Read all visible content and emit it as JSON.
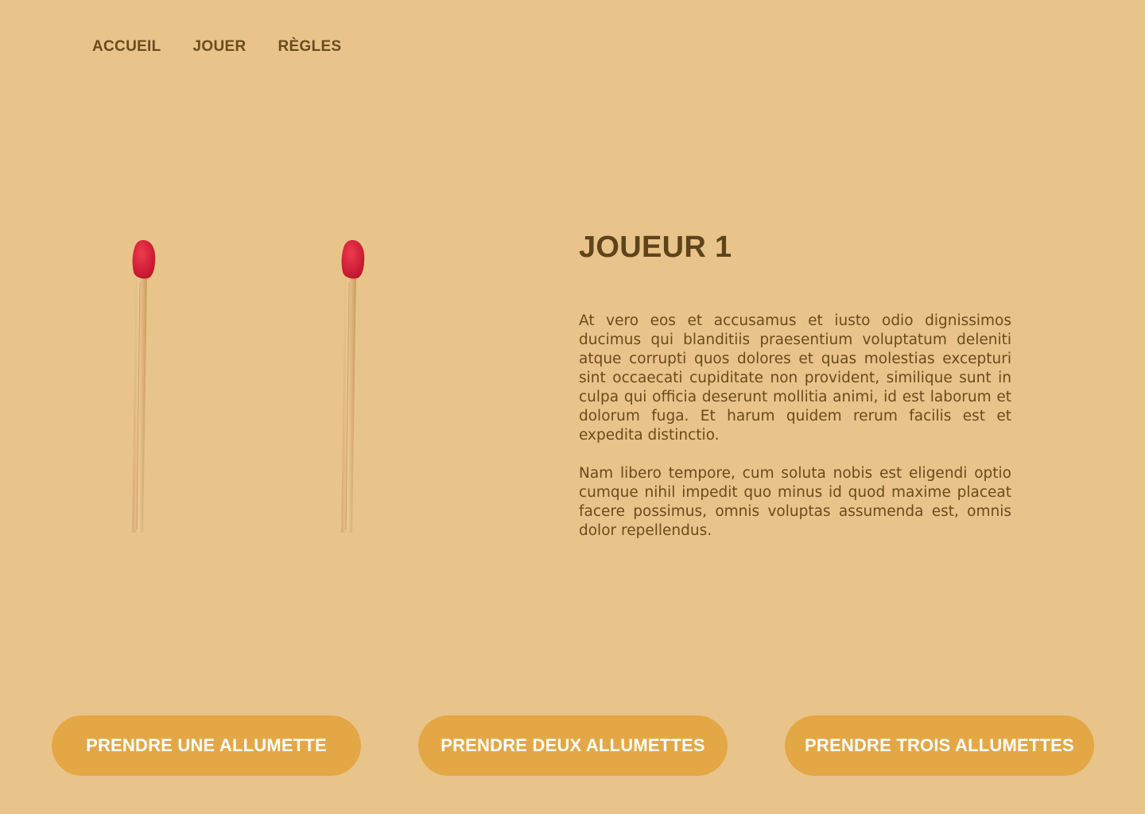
{
  "nav": {
    "items": [
      {
        "label": "ACCUEIL"
      },
      {
        "label": "JOUER"
      },
      {
        "label": "RÈGLES"
      }
    ]
  },
  "game": {
    "matches_remaining": 2
  },
  "player": {
    "title": "JOUEUR 1"
  },
  "content": {
    "paragraphs": [
      "At vero eos et accusamus et iusto odio dignissimos ducimus qui blanditiis praesentium voluptatum deleniti atque corrupti quos dolores et quas molestias excepturi sint occaecati cupiditate non provident, similique sunt in culpa qui officia deserunt mollitia animi, id est laborum et dolorum fuga. Et harum quidem rerum facilis est et expedita distinctio.",
      "Nam libero tempore, cum soluta nobis est eligendi optio cumque nihil impedit quo minus id quod maxime placeat facere possimus, omnis voluptas assumenda est, omnis dolor repellendus."
    ]
  },
  "actions": {
    "take_one": "PRENDRE UNE ALLUMETTE",
    "take_two": "PRENDRE DEUX ALLUMETTES",
    "take_three": "PRENDRE TROIS ALLUMETTES"
  },
  "colors": {
    "background": "#e8c48a",
    "nav_text": "#6b4a1c",
    "button": "#e4a745",
    "match_head": "#d8203a",
    "match_stick": "#dfb87f"
  }
}
